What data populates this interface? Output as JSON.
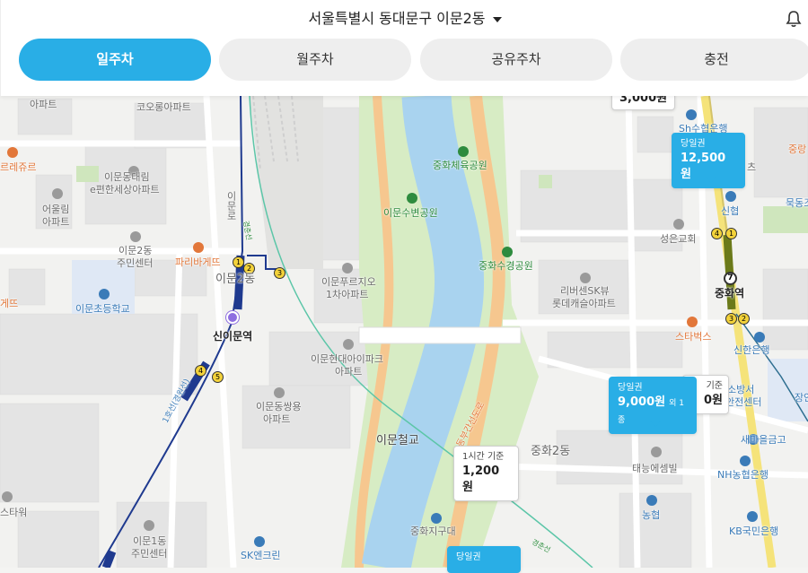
{
  "header": {
    "location": "서울특별시 동대문구 이문2동",
    "tabs": [
      {
        "label": "일주차",
        "active": true
      },
      {
        "label": "월주차",
        "active": false
      },
      {
        "label": "공유주차",
        "active": false
      },
      {
        "label": "충전",
        "active": false
      }
    ]
  },
  "colors": {
    "accent": "#29aee6",
    "river": "#a9d3ef",
    "park": "#d7ecc4",
    "road_major": "#f6c78f",
    "line1": "#1f3a8f",
    "line7": "#6b7a1a"
  },
  "price_cards": [
    {
      "type": "",
      "price": "3,000원"
    },
    {
      "type": "당일권",
      "price": "12,500원"
    },
    {
      "type": "당일권",
      "price": "9,000원",
      "extra": "외 1종"
    },
    {
      "type": "기준",
      "price": "0원"
    },
    {
      "type": "1시간 기준",
      "price": "1,200원"
    },
    {
      "type": "당일권",
      "price": ""
    }
  ],
  "map_labels": {
    "apt_top_left": "아파트",
    "kolon": "코오롱아파트",
    "le_jureu": "르레쥬르",
    "daerim": "이문동대림",
    "daerim2": "e편한세상아파트",
    "eourim": "어울림",
    "eourim2": "아파트",
    "comm2": "이문2동",
    "comm2b": "주민센터",
    "paris": "파리바게뜨",
    "gepe": "게뜨",
    "school": "이문초등학교",
    "imun_ro": "이문로",
    "imun2dong": "이문2동",
    "pureujio": "이문푸르지오",
    "pureujio2": "1차아파트",
    "hyundai": "이문현대아이파크",
    "hyundai2": "아파트",
    "ssangyong": "이문동쌍용",
    "ssangyong2": "아파트",
    "station_sinimun": "신이문역",
    "stawor": "스타워",
    "imun1": "이문1동",
    "imun1b": "주민센터",
    "sk_clean": "SK엔크린",
    "line1_name": "1호선(경원선)",
    "gyeongchun": "경춘선",
    "gyeongchun2": "경춘선",
    "imun_bridge": "이문철교",
    "junghwa_sports": "중화체육공원",
    "imun_park": "이문수변공원",
    "junghwa_park": "중화수경공원",
    "riversen": "리버센SK뷰",
    "riversen2": "롯데캐슬아파트",
    "road_east": "동부간선도로",
    "junghwa2": "중화2동",
    "junghwa_district": "중화지구대",
    "teneung": "태능에셈빌",
    "nonghyup": "농협",
    "nh_bank": "NH농협은행",
    "kb_bank": "KB국민은행",
    "starbucks": "스타벅스",
    "shinhan": "신한은행",
    "seongeun": "성은교회",
    "station_junghwa": "중화역",
    "sinhyup": "신협",
    "sh_bank": "Sh수협은행",
    "junghwa_right": "중랑",
    "mukdong": "묵동조",
    "fire": "소방서",
    "fire2": "안전센터",
    "saemaeul": "새마을금고",
    "jangan": "장안",
    "ches": "츠"
  },
  "station_markers": [
    "1",
    "2",
    "3",
    "4",
    "5",
    "7",
    "4",
    "1",
    "3",
    "2"
  ]
}
